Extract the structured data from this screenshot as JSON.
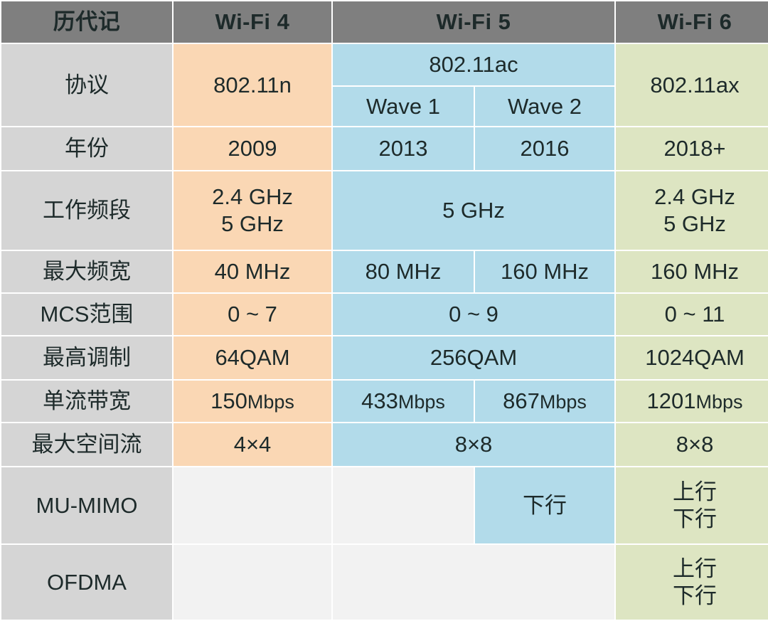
{
  "table": {
    "header": {
      "label_column": "历代记",
      "generations": [
        "Wi-Fi 4",
        "Wi-Fi 5",
        "Wi-Fi 6"
      ]
    },
    "colors": {
      "header_gray": "#7f7f7f",
      "label_gray": "#d5d5d5",
      "wifi4_orange": "#fad7b4",
      "wifi5_blue": "#b2dbea",
      "wifi6_green": "#dde5c2",
      "empty_cell": "#f2f2f2"
    },
    "wave_labels": {
      "wave1": "Wave 1",
      "wave2": "Wave 2"
    },
    "rows": {
      "protocol": {
        "label": "协议",
        "wifi4": "802.11n",
        "wifi5": "802.11ac",
        "wifi6": "802.11ax"
      },
      "year": {
        "label": "年份",
        "wifi4": "2009",
        "wave1": "2013",
        "wave2": "2016",
        "wifi6": "2018+"
      },
      "band": {
        "label": "工作频段",
        "wifi4_line1": "2.4 GHz",
        "wifi4_line2": "5 GHz",
        "wifi5": "5 GHz",
        "wifi6_line1": "2.4 GHz",
        "wifi6_line2": "5 GHz"
      },
      "bandwidth": {
        "label": "最大频宽",
        "wifi4": "40 MHz",
        "wave1": "80 MHz",
        "wave2": "160 MHz",
        "wifi6": "160 MHz"
      },
      "mcs": {
        "label": "MCS范围",
        "wifi4": "0 ~ 7",
        "wifi5": "0 ~ 9",
        "wifi6": "0 ~ 11"
      },
      "modulation": {
        "label": "最高调制",
        "wifi4": "64QAM",
        "wifi5": "256QAM",
        "wifi6": "1024QAM"
      },
      "stream_rate": {
        "label": "单流带宽",
        "wifi4_value": "150",
        "wifi4_unit": "Mbps",
        "wave1_value": "433",
        "wave1_unit": "Mbps",
        "wave2_value": "867",
        "wave2_unit": "Mbps",
        "wifi6_value": "1201",
        "wifi6_unit": "Mbps"
      },
      "spatial_streams": {
        "label": "最大空间流",
        "wifi4": "4×4",
        "wifi5": "8×8",
        "wifi6": "8×8"
      },
      "mu_mimo": {
        "label": "MU-MIMO",
        "wifi4": "",
        "wave1": "",
        "wave2": "下行",
        "wifi6_line1": "上行",
        "wifi6_line2": "下行"
      },
      "ofdma": {
        "label": "OFDMA",
        "wifi4": "",
        "wifi5": "",
        "wifi6_line1": "上行",
        "wifi6_line2": "下行"
      }
    }
  }
}
